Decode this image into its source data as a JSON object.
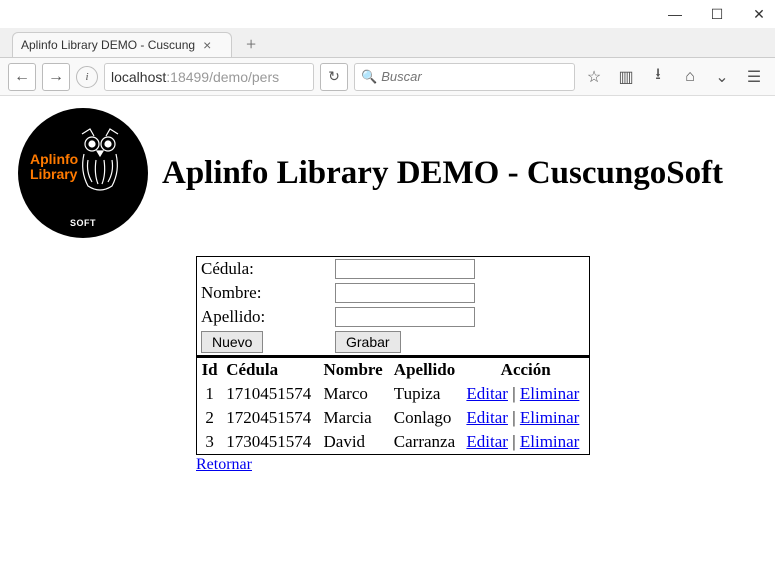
{
  "window": {
    "tab_title": "Aplinfo Library DEMO - Cuscung"
  },
  "url": {
    "host": "localhost",
    "rest": ":18499/demo/pers"
  },
  "search": {
    "placeholder": "Buscar"
  },
  "logo": {
    "line1": "Aplinfo",
    "line2": "Library",
    "soft": "SOFT"
  },
  "title": "Aplinfo Library DEMO - CuscungoSoft",
  "form": {
    "cedula_label": "Cédula:",
    "nombre_label": "Nombre:",
    "apellido_label": "Apellido:",
    "nuevo": "Nuevo",
    "grabar": "Grabar"
  },
  "table": {
    "headers": {
      "id": "Id",
      "cedula": "Cédula",
      "nombre": "Nombre",
      "apellido": "Apellido",
      "accion": "Acción"
    },
    "rows": [
      {
        "id": "1",
        "cedula": "1710451574",
        "nombre": "Marco",
        "apellido": "Tupiza"
      },
      {
        "id": "2",
        "cedula": "1720451574",
        "nombre": "Marcia",
        "apellido": "Conlago"
      },
      {
        "id": "3",
        "cedula": "1730451574",
        "nombre": "David",
        "apellido": "Carranza"
      }
    ],
    "edit": "Editar",
    "sep": " | ",
    "delete": "Eliminar"
  },
  "retornar": "Retornar"
}
